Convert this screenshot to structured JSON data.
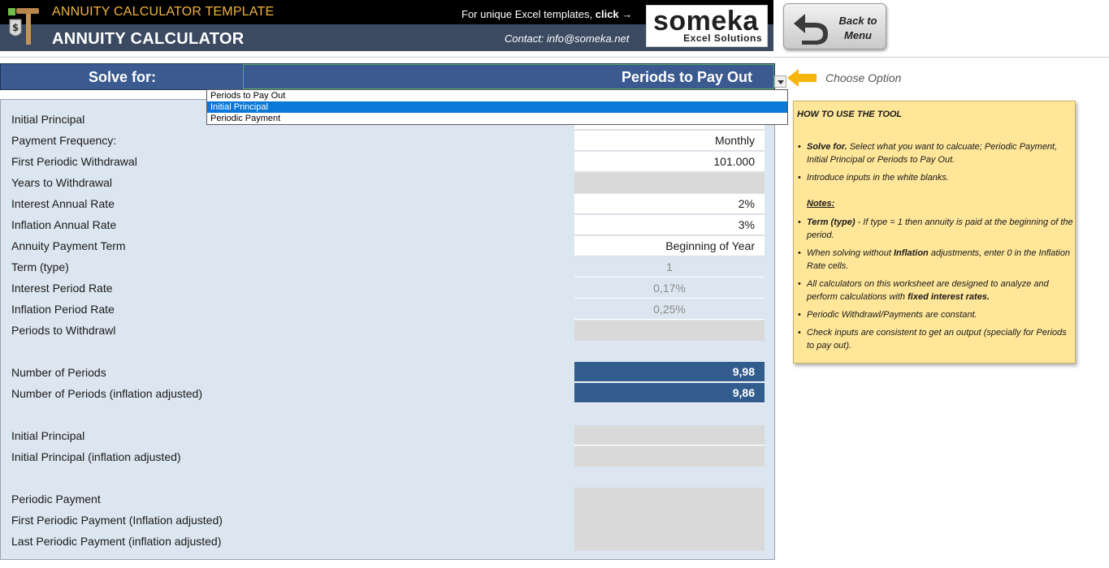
{
  "header": {
    "template_title": "ANNUITY CALCULATOR TEMPLATE",
    "app_title": "ANNUITY CALCULATOR",
    "promo_text": "For unique Excel templates, ",
    "promo_link": "click",
    "promo_arrow": "→",
    "contact": "Contact: info@someka.net",
    "brand_name": "someka",
    "brand_sub": "Excel Solutions",
    "back_label": "Back to Menu"
  },
  "solve": {
    "label": "Solve for:",
    "value": "Periods to Pay Out",
    "hint": "Choose Option",
    "options": [
      "Periods to Pay Out",
      "Initial Principal",
      "Periodic Payment"
    ],
    "selected_option": "Initial Principal"
  },
  "inputs": {
    "initial_principal_label": "Initial Principal",
    "payment_frequency_label": "Payment Frequency:",
    "payment_frequency_value": "Monthly",
    "first_withdrawal_label": "First Periodic Withdrawal",
    "first_withdrawal_value": "101.000",
    "years_to_withdrawal_label": "Years to Withdrawal",
    "interest_annual_label": "Interest Annual Rate",
    "interest_annual_value": "2%",
    "inflation_annual_label": "Inflation Annual Rate",
    "inflation_annual_value": "3%",
    "payment_term_label": "Annuity Payment Term",
    "payment_term_value": "Beginning of Year",
    "term_type_label": "Term (type)",
    "term_type_value": "1",
    "interest_period_label": "Interest Period Rate",
    "interest_period_value": "0,17%",
    "inflation_period_label": "Inflation Period Rate",
    "inflation_period_value": "0,25%",
    "periods_withdrawl_label": "Periods to Withdrawl"
  },
  "results": {
    "number_of_periods_label": "Number of Periods",
    "number_of_periods_value": "9,98",
    "number_of_periods_infl_label": "Number of Periods (inflation adjusted)",
    "number_of_periods_infl_value": "9,86",
    "initial_principal_label": "Initial Principal",
    "initial_principal_infl_label": "Initial Principal (inflation adjusted)",
    "periodic_payment_label": "Periodic Payment",
    "first_payment_infl_label": "First Periodic Payment (Inflation adjusted)",
    "last_payment_infl_label": "Last Periodic Payment (inflation adjusted)"
  },
  "help": {
    "title": "HOW TO USE THE TOOL",
    "solve_for_bold": "Solve for.",
    "solve_for_text": " Select what you want to calcuate; Periodic Payment, Initial Principal or Periods to Pay Out.",
    "introduce": "Introduce inputs in the white blanks.",
    "notes": "Notes:",
    "term_bold": "Term (type)",
    "term_text": " - If type = 1  then annuity is paid at the beginning of the period.",
    "inflation_pre": "When solving without ",
    "inflation_bold": "Inflation",
    "inflation_post": " adjustments, enter 0 in the Inflation Rate cells.",
    "calculators_pre": "All calculators on this worksheet are designed to analyze and perform calculations with ",
    "calculators_bold": "fixed interest rates.",
    "constant": "Periodic Withdrawl/Payments are constant.",
    "check": "Check inputs are consistent to get an output (specially for Periods to pay out)."
  },
  "colors": {
    "header_dark": "#000000",
    "header_slate": "#3b4a61",
    "accent_orange": "#f0b43c",
    "solve_blue": "#3a5a90",
    "panel_bg": "#dce6f0",
    "result_blue": "#335c8e",
    "help_yellow": "#ffe699"
  }
}
